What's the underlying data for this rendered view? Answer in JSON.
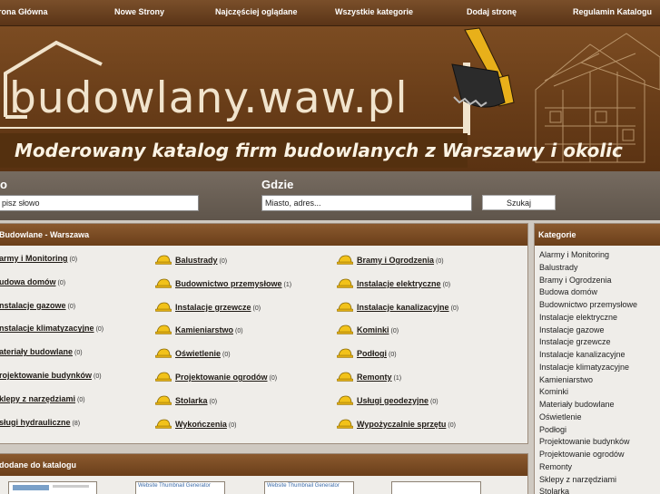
{
  "nav": {
    "home": "rona Główna",
    "new_pages": "Nowe Strony",
    "most_viewed": "Najczęściej oglądane",
    "all_categories": "Wszystkie kategorie",
    "add_page": "Dodaj stronę",
    "rules": "Regulamin Katalogu"
  },
  "banner": {
    "logo": "budowlany.waw.pl",
    "tagline": "Moderowany katalog firm budowlanych z Warszawy i okolic"
  },
  "search": {
    "what_label": "o",
    "what_value": "pisz słowo",
    "where_label": "Gdzie",
    "where_value": "Miasto, adres...",
    "button": "Szukaj"
  },
  "main": {
    "title": "Budowlane - Warszawa",
    "categories": [
      {
        "name": "army i Monitoring",
        "count": "(0)"
      },
      {
        "name": "Balustrady",
        "count": "(0)"
      },
      {
        "name": "Bramy i Ogrodzenia",
        "count": "(0)"
      },
      {
        "name": "udowa domów",
        "count": "(0)"
      },
      {
        "name": "Budownictwo przemysłowe",
        "count": "(1)"
      },
      {
        "name": "Instalacje elektryczne",
        "count": "(0)"
      },
      {
        "name": "nstalacje gazowe",
        "count": "(0)"
      },
      {
        "name": "Instalacje grzewcze",
        "count": "(0)"
      },
      {
        "name": "Instalacje kanalizacyjne",
        "count": "(0)"
      },
      {
        "name": "nstalacje klimatyzacyjne",
        "count": "(0)"
      },
      {
        "name": "Kamieniarstwo",
        "count": "(0)"
      },
      {
        "name": "Kominki",
        "count": "(0)"
      },
      {
        "name": "ateriały budowlane",
        "count": "(0)"
      },
      {
        "name": "Oświetlenie",
        "count": "(0)"
      },
      {
        "name": "Podłogi",
        "count": "(0)"
      },
      {
        "name": "rojektowanie budynków",
        "count": "(0)"
      },
      {
        "name": "Projektowanie ogrodów",
        "count": "(0)"
      },
      {
        "name": "Remonty",
        "count": "(1)"
      },
      {
        "name": "klepy z narzędziami",
        "count": "(0)"
      },
      {
        "name": "Stolarka",
        "count": "(0)"
      },
      {
        "name": "Usługi geodezyjne",
        "count": "(0)"
      },
      {
        "name": "sługi hydrauliczne",
        "count": "(8)"
      },
      {
        "name": "Wykończenia",
        "count": "(0)"
      },
      {
        "name": "Wypożyczalnie sprzętu",
        "count": "(0)"
      }
    ]
  },
  "added": {
    "title": "dodane do katalogu",
    "thumbs": [
      "Website Thumbnail Generator",
      "Website Thumbnail Generator"
    ]
  },
  "sidebar": {
    "title": "Kategorie",
    "items": [
      "Alarmy i Monitoring",
      "Balustrady",
      "Bramy i Ogrodzenia",
      "Budowa domów",
      "Budownictwo przemysłowe",
      "Instalacje elektryczne",
      "Instalacje gazowe",
      "Instalacje grzewcze",
      "Instalacje kanalizacyjne",
      "Instalacje klimatyzacyjne",
      "Kamieniarstwo",
      "Kominki",
      "Materiały budowlane",
      "Oświetlenie",
      "Podłogi",
      "Projektowanie budynków",
      "Projektowanie ogrodów",
      "Remonty",
      "Sklepy z narzędziami",
      "Stolarka"
    ]
  },
  "colors": {
    "accent": "#6a3e19",
    "logo": "#f1e4cd",
    "helmet": "#f2c21a"
  },
  "icons": {
    "category": "hard-hat-icon"
  }
}
